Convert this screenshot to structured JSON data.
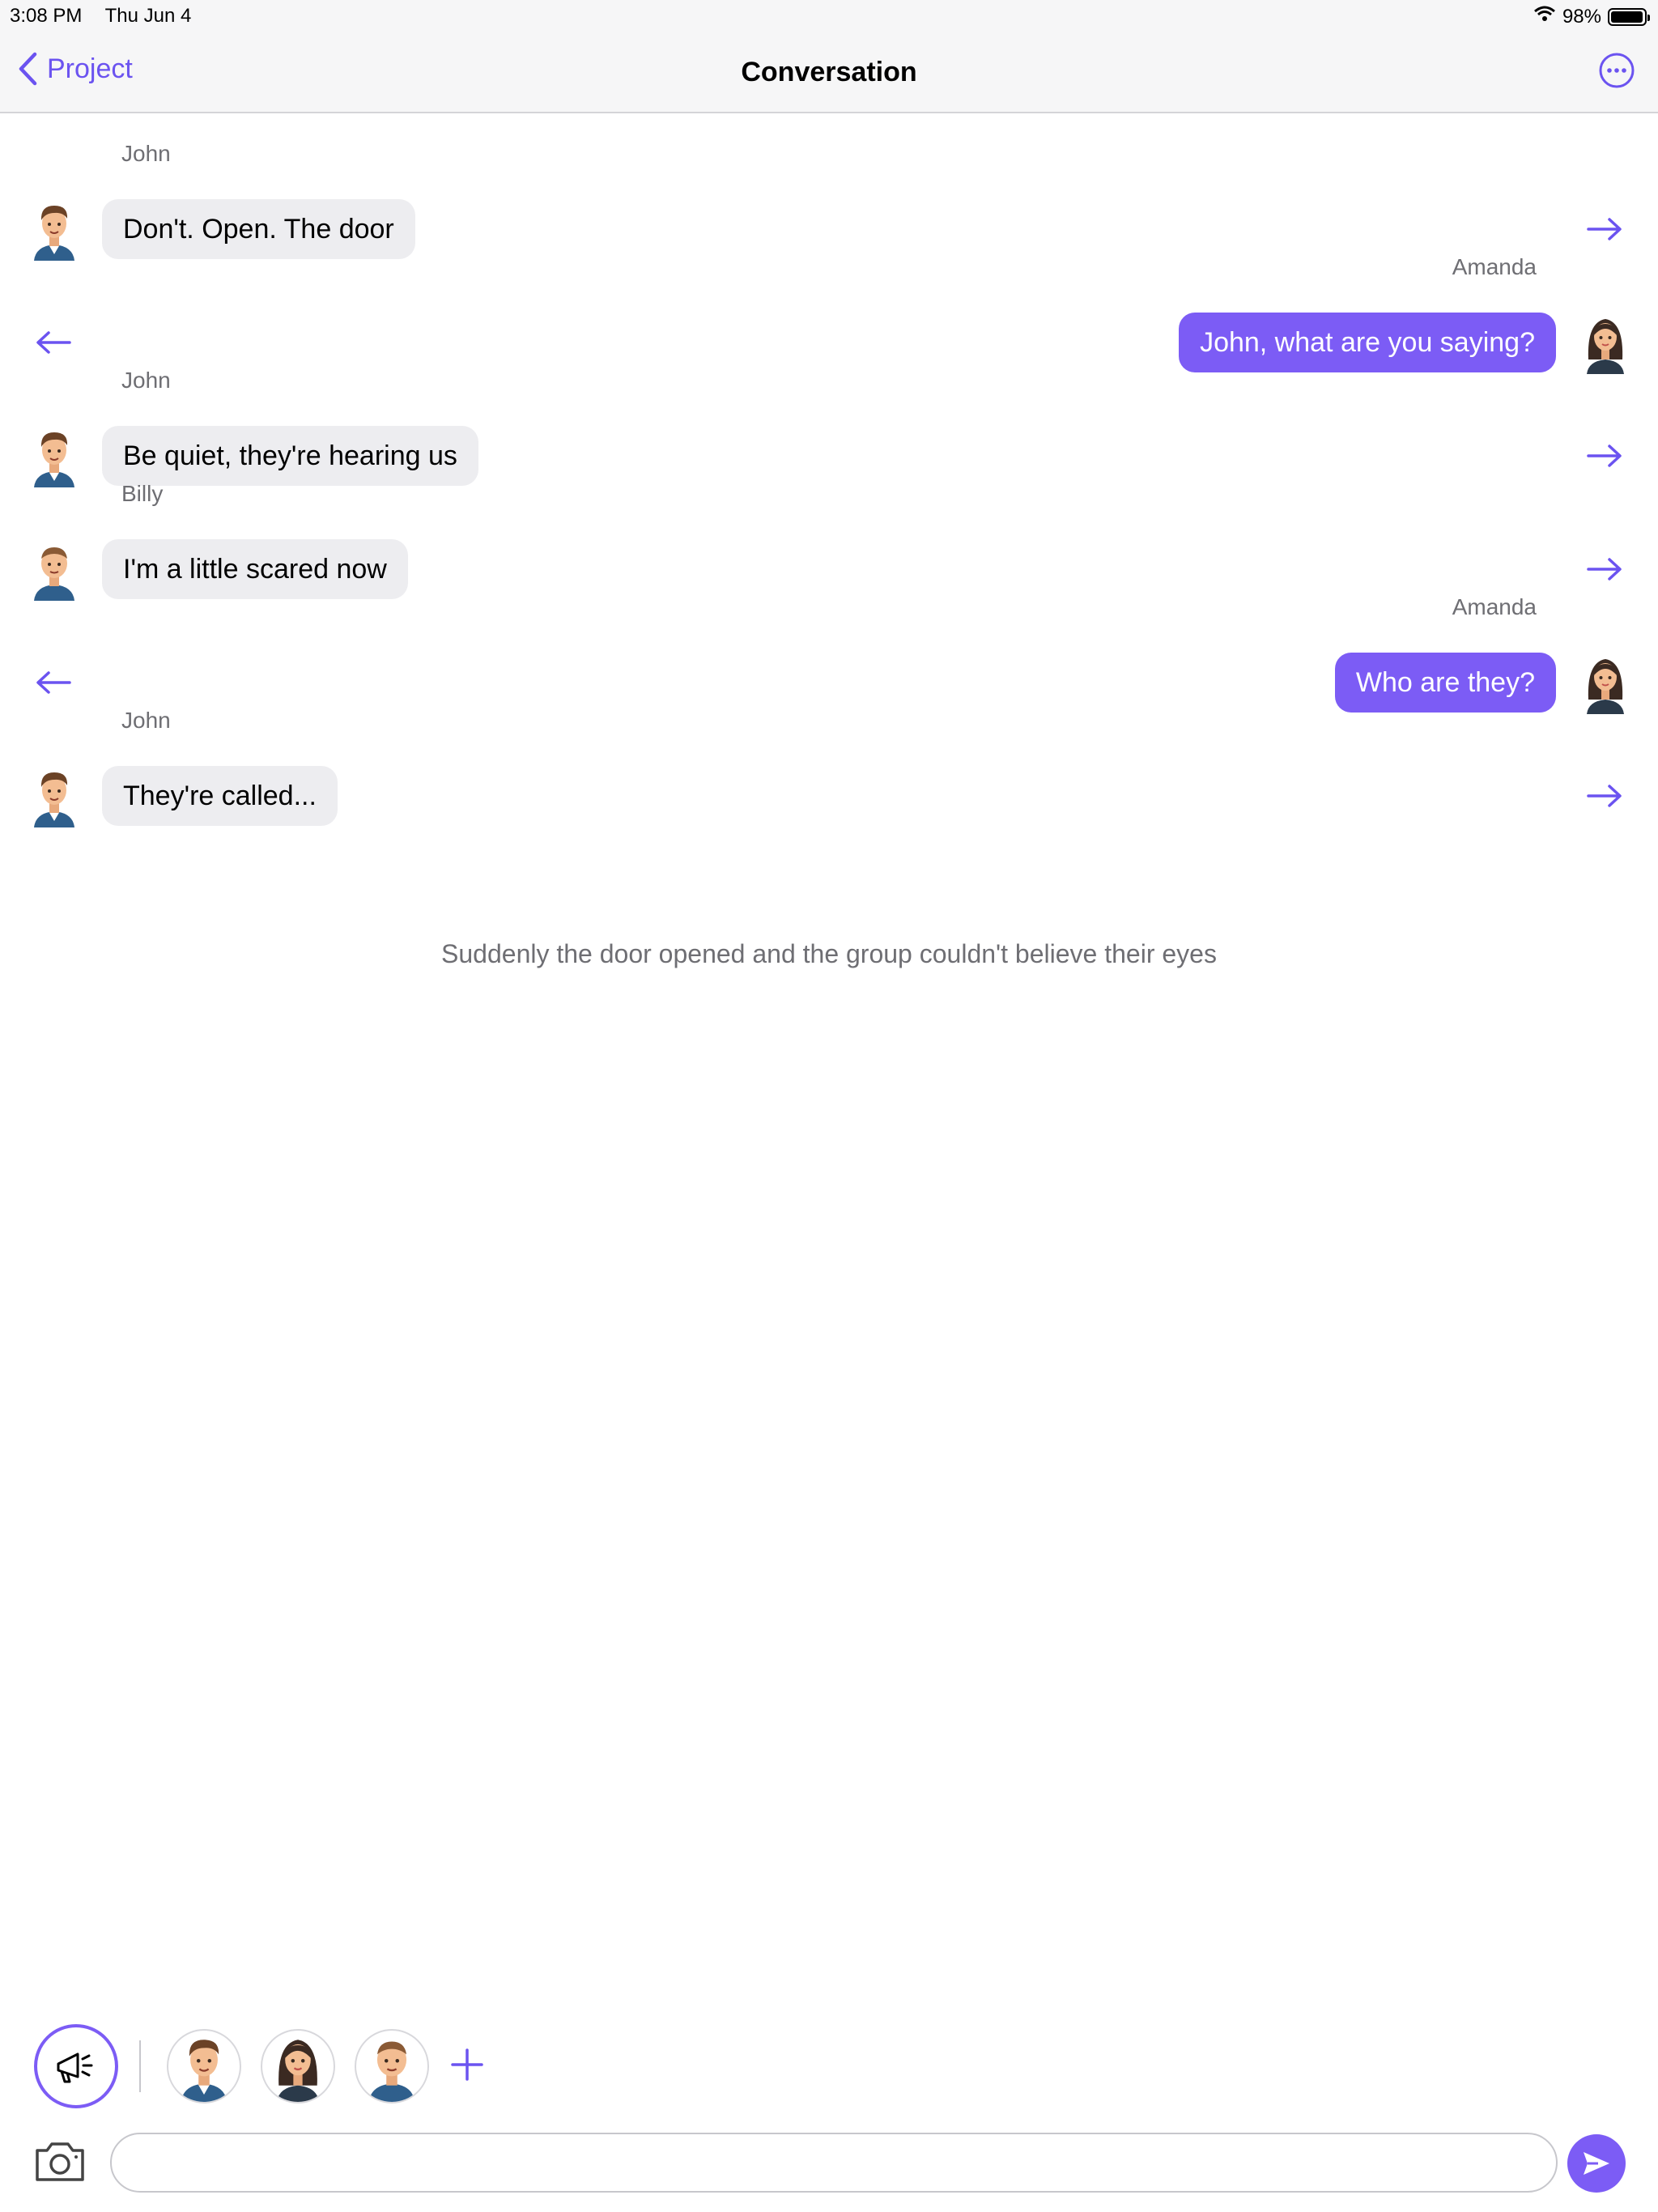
{
  "status_bar": {
    "time": "3:08 PM",
    "date": "Thu Jun 4",
    "battery": "98%",
    "battery_level": 0.98
  },
  "nav": {
    "back_label": "Project",
    "title": "Conversation"
  },
  "characters": {
    "john": {
      "name": "John"
    },
    "amanda": {
      "name": "Amanda"
    },
    "billy": {
      "name": "Billy"
    }
  },
  "messages": [
    {
      "sender": "John",
      "text": "Don't. Open. The door",
      "side": "left"
    },
    {
      "sender": "Amanda",
      "text": "John, what are you saying?",
      "side": "right"
    },
    {
      "sender": "John",
      "text": "Be quiet, they're hearing us",
      "side": "left"
    },
    {
      "sender": "Billy",
      "text": "I'm a little scared now",
      "side": "left"
    },
    {
      "sender": "Amanda",
      "text": "Who are they?",
      "side": "right"
    },
    {
      "sender": "John",
      "text": "They're called...",
      "side": "left"
    }
  ],
  "narration": "Suddenly the door opened and the group couldn't believe their eyes",
  "composer": {
    "placeholder": ""
  },
  "colors": {
    "accent": "#7c5cf5",
    "bubble_in": "#ededf0",
    "secondary_text": "#6e6e73"
  },
  "icons": {
    "back": "chevron-left-icon",
    "more": "ellipsis-circle-icon",
    "narrator": "megaphone-icon",
    "camera": "camera-icon",
    "send": "paper-plane-icon",
    "add": "plus-icon",
    "move_right": "arrow-right-icon",
    "move_left": "arrow-left-icon"
  }
}
